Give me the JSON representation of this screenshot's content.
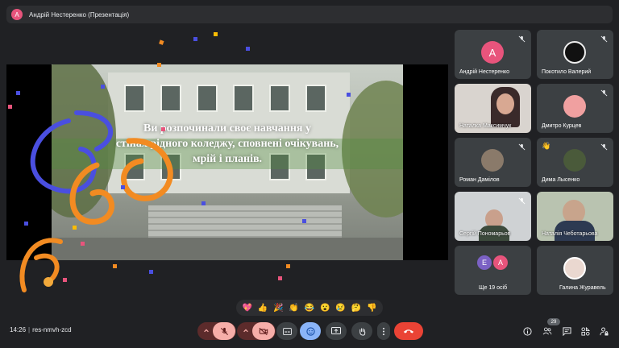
{
  "presenter_bar": {
    "avatar_letter": "А",
    "title": "Андрій Нестеренко (Презентація)"
  },
  "slide": {
    "lines": [
      "Ви розпочинали своє навчання у",
      "стінах рідного коледжу, сповнені очікувань,",
      "мрій і планів."
    ]
  },
  "participants": [
    {
      "name": "Андрій Нестеренко",
      "avatar_letter": "А",
      "avatar_color": "#e8547c"
    },
    {
      "name": "Покотило Валерий"
    },
    {
      "name": "Наталка Максимчук"
    },
    {
      "name": "Дмитро Курцев"
    },
    {
      "name": "Роман Дамілов"
    },
    {
      "name": "Дима Лысенко"
    },
    {
      "name": "Сергій Пономарьов"
    },
    {
      "name": "Наталія Чеботарьова"
    },
    {
      "name": "Ще 19 осіб",
      "avatar_letters": [
        "Е",
        "А"
      ]
    },
    {
      "name": "Галина Журавель"
    }
  ],
  "reactions": [
    "💖",
    "👍",
    "🎉",
    "👏",
    "😂",
    "😮",
    "😢",
    "🤔",
    "👎"
  ],
  "bottom_bar": {
    "time": "14:26",
    "meeting_code": "res-nmvh-zcd",
    "people_count": "29"
  },
  "colors": {
    "background": "#202124",
    "tile": "#3c4043",
    "hangup": "#ea4335",
    "active": "#8ab4f8"
  }
}
